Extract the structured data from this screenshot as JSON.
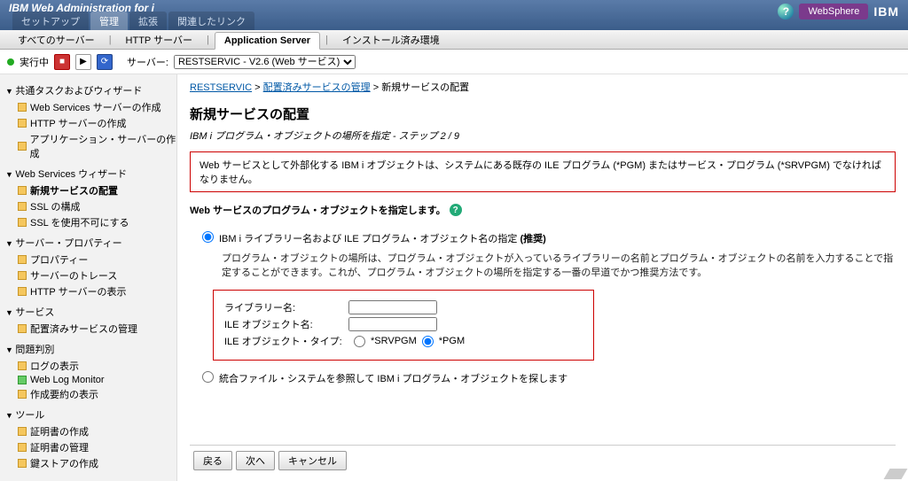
{
  "header": {
    "title": "IBM Web Administration for i",
    "tabs": [
      "セットアップ",
      "管理",
      "拡張",
      "関連したリンク"
    ],
    "active_tab_index": 1,
    "websphere": "WebSphere",
    "ibm": "IBM"
  },
  "subbar": {
    "items": [
      "すべてのサーバー",
      "HTTP サーバー",
      "Application Server",
      "インストール済み環境"
    ],
    "active_index": 2
  },
  "status": {
    "label": "実行中",
    "server_label": "サーバー:",
    "server_value": "RESTSERVIC - V2.6 (Web サービス)"
  },
  "sidebar": {
    "groups": [
      {
        "title": "共通タスクおよびウィザード",
        "items": [
          {
            "label": "Web Services サーバーの作成",
            "icon": "yellow"
          },
          {
            "label": "HTTP サーバーの作成",
            "icon": "yellow"
          },
          {
            "label": "アプリケーション・サーバーの作成",
            "icon": "yellow"
          }
        ]
      },
      {
        "title": "Web Services ウィザード",
        "items": [
          {
            "label": "新規サービスの配置",
            "icon": "yellow",
            "active": true
          },
          {
            "label": "SSL の構成",
            "icon": "yellow"
          },
          {
            "label": "SSL を使用不可にする",
            "icon": "yellow"
          }
        ]
      },
      {
        "title": "サーバー・プロパティー",
        "items": [
          {
            "label": "プロパティー",
            "icon": "yellow"
          },
          {
            "label": "サーバーのトレース",
            "icon": "yellow"
          },
          {
            "label": "HTTP サーバーの表示",
            "icon": "yellow"
          }
        ]
      },
      {
        "title": "サービス",
        "items": [
          {
            "label": "配置済みサービスの管理",
            "icon": "yellow"
          }
        ]
      },
      {
        "title": "問題判別",
        "items": [
          {
            "label": "ログの表示",
            "icon": "yellow"
          },
          {
            "label": "Web Log Monitor",
            "icon": "green"
          },
          {
            "label": "作成要約の表示",
            "icon": "yellow"
          }
        ]
      },
      {
        "title": "ツール",
        "items": [
          {
            "label": "証明書の作成",
            "icon": "yellow"
          },
          {
            "label": "証明書の管理",
            "icon": "yellow"
          },
          {
            "label": "鍵ストアの作成",
            "icon": "yellow"
          }
        ]
      }
    ]
  },
  "main": {
    "breadcrumb": {
      "link1": "RESTSERVIC",
      "link2": "配置済みサービスの管理",
      "current": "新規サービスの配置"
    },
    "heading": "新規サービスの配置",
    "substep": "IBM i プログラム・オブジェクトの場所を指定 - ステップ 2 / 9",
    "warning": "Web サービスとして外部化する IBM i オブジェクトは、システムにある既存の ILE プログラム (*PGM) またはサービス・プログラム (*SRVPGM) でなければなりません。",
    "sectionlabel": "Web サービスのプログラム・オブジェクトを指定します。",
    "radio1_label": "IBM i ライブラリー名および ILE プログラム・オブジェクト名の指定 (推奨)",
    "hint": "プログラム・オブジェクトの場所は、プログラム・オブジェクトが入っているライブラリーの名前とプログラム・オブジェクトの名前を入力することで指定することができます。これが、プログラム・オブジェクトの場所を指定する一番の早道でかつ推奨方法です。",
    "form": {
      "library_label": "ライブラリー名:",
      "ileobj_label": "ILE オブジェクト名:",
      "type_label": "ILE オブジェクト・タイプ:",
      "type_srvpgm": "*SRVPGM",
      "type_pgm": "*PGM"
    },
    "radio2_label": "統合ファイル・システムを参照して IBM i プログラム・オブジェクトを探します",
    "buttons": {
      "back": "戻る",
      "next": "次へ",
      "cancel": "キャンセル"
    }
  }
}
